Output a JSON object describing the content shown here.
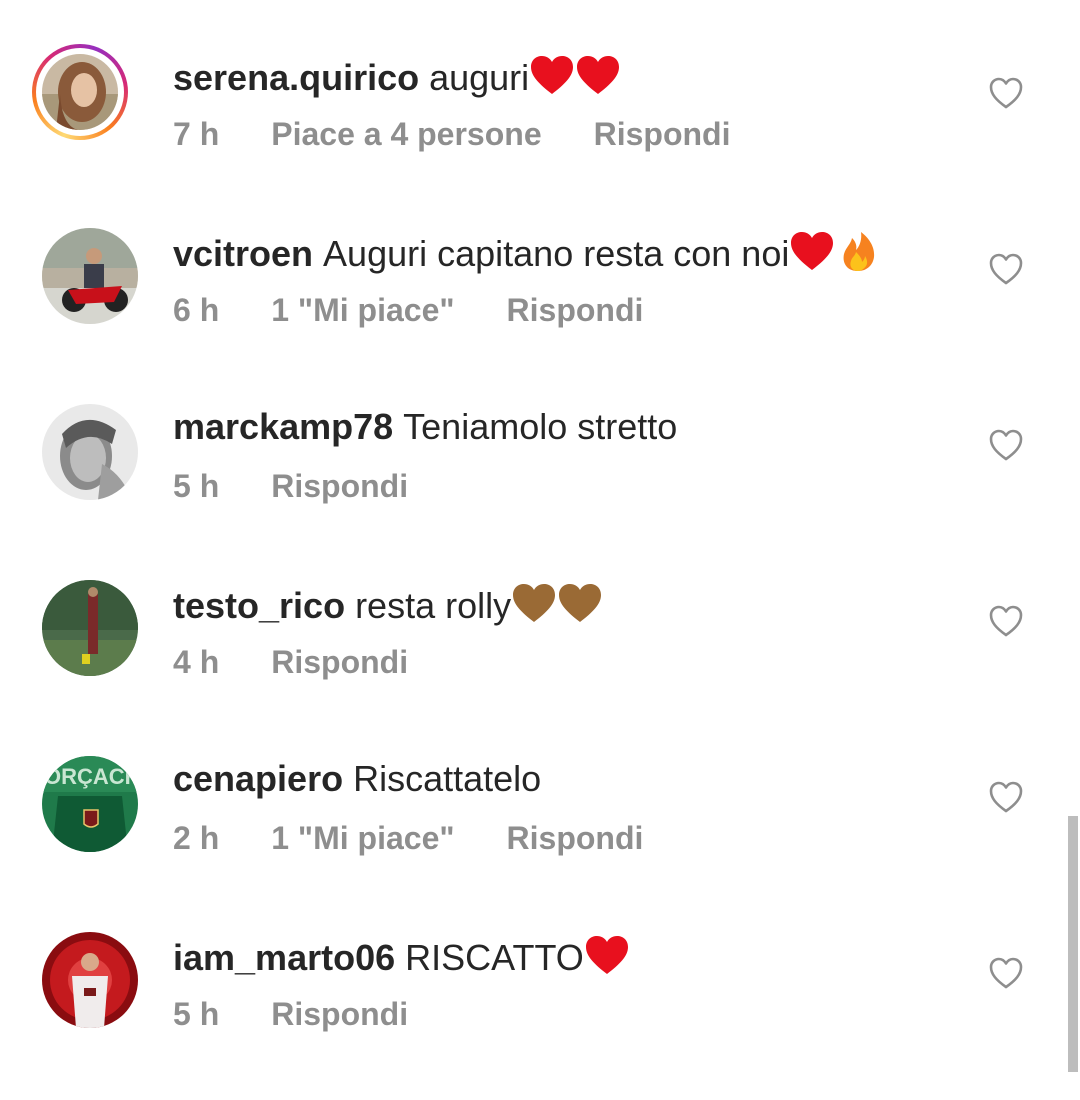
{
  "comments": [
    {
      "username": "serena.quirico",
      "text": "auguri",
      "emojis": [
        "red-heart",
        "red-heart"
      ],
      "time": "7 h",
      "likes": "Piace a 4 persone",
      "reply": "Rispondi",
      "story_ring": true
    },
    {
      "username": "vcitroen",
      "text": "Auguri capitano resta con noi",
      "emojis": [
        "red-heart",
        "fire"
      ],
      "time": "6 h",
      "likes": "1 \"Mi piace\"",
      "reply": "Rispondi",
      "story_ring": false
    },
    {
      "username": "marckamp78",
      "text": "Teniamolo stretto",
      "emojis": [],
      "time": "5 h",
      "likes": "",
      "reply": "Rispondi",
      "story_ring": false
    },
    {
      "username": "testo_rico",
      "text": "resta rolly",
      "emojis": [
        "brown-heart",
        "brown-heart"
      ],
      "time": "4 h",
      "likes": "",
      "reply": "Rispondi",
      "story_ring": false
    },
    {
      "username": "cenapiero",
      "text": "Riscattatelo",
      "emojis": [],
      "time": "2 h",
      "likes": "1 \"Mi piace\"",
      "reply": "Rispondi",
      "story_ring": false
    },
    {
      "username": "iam_marto06",
      "text": "RISCATTO",
      "emojis": [
        "red-heart"
      ],
      "time": "5 h",
      "likes": "",
      "reply": "Rispondi",
      "story_ring": false
    }
  ],
  "avatar_texts": {
    "cenapiero": "ORÇACHI"
  },
  "colors": {
    "text": "#262626",
    "meta": "#8e8e8e",
    "red_heart": "#e8101e",
    "brown_heart": "#9a6a35",
    "fire": "#f6821f"
  }
}
